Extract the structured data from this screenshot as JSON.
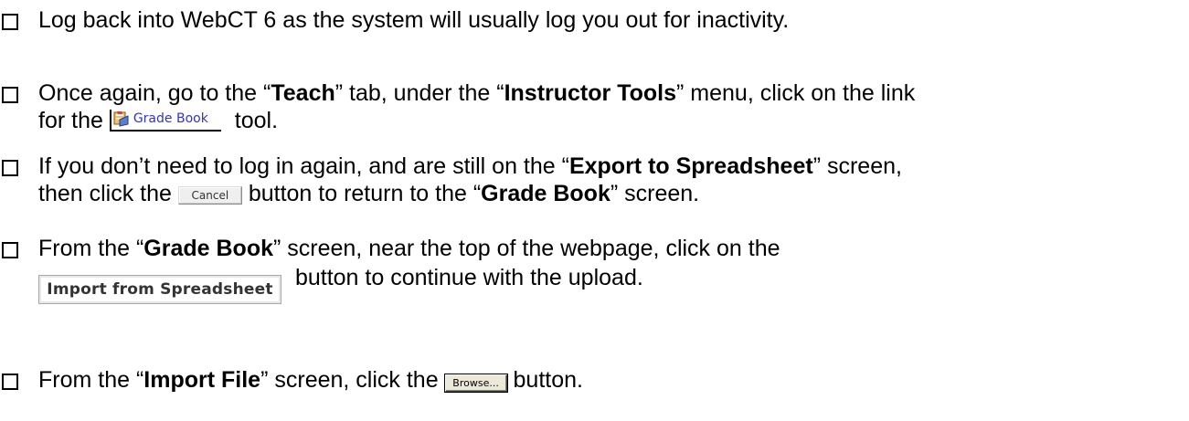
{
  "steps": [
    {
      "line1": "Log back into WebCT 6 as the system will usually log you out for inactivity."
    },
    {
      "line1_a": "Once again, go to the “",
      "line1_b": "Teach",
      "line1_c": "” tab, under the “",
      "line1_d": "Instructor Tools",
      "line1_e": "” menu, click on the link",
      "line2_a": "for the",
      "line2_b": "tool."
    },
    {
      "line1_a": "If you don’t need to log in again, and are still on the “",
      "line1_b": "Export to Spreadsheet",
      "line1_c": "” screen,",
      "line2_a": "then click the",
      "line2_b": "button to return to the “",
      "line2_c": "Grade Book",
      "line2_d": "” screen."
    },
    {
      "line1_a": "From the “",
      "line1_b": "Grade Book",
      "line1_c": "” screen, near the top of the webpage, click on the",
      "line2_b": "button to continue with the upload."
    },
    {
      "line1_a": "From the “",
      "line1_b": "Import File",
      "line1_c": "” screen, click the",
      "line1_d": "button."
    }
  ],
  "ui": {
    "gradebook_link_label": "Grade Book",
    "cancel_label": "Cancel",
    "import_label": "Import from Spreadsheet",
    "browse_label": "Browse...",
    "gradebook_icon": "gradebook-icon",
    "checkbox_icon": "checkbox-icon"
  }
}
